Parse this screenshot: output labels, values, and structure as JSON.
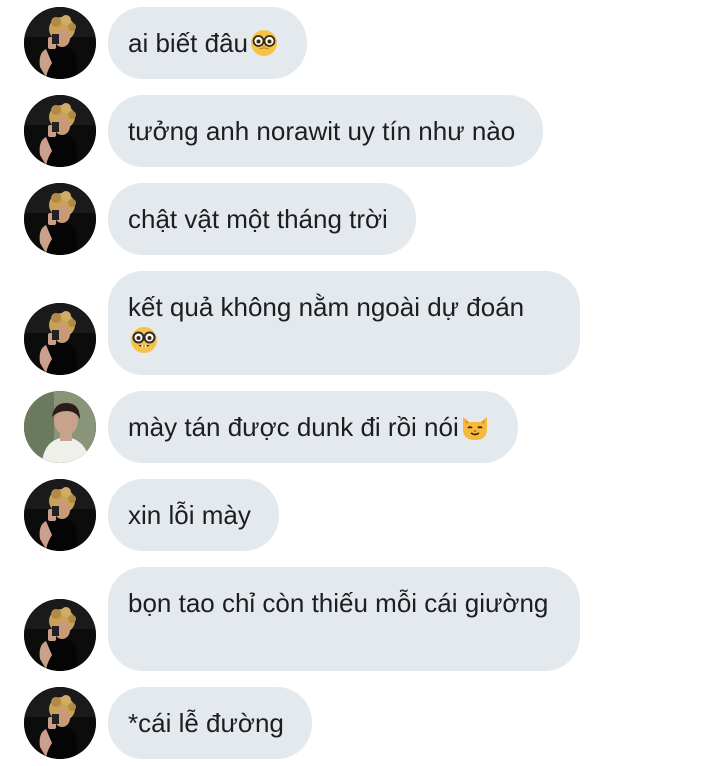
{
  "messages": [
    {
      "text": "ai biết đâu",
      "emoji": "disguised-face-emoji",
      "sender": "user-a"
    },
    {
      "text": "tưởng anh norawit uy tín như nào",
      "emoji": "",
      "sender": "user-a"
    },
    {
      "text": "chật vật một tháng trời",
      "emoji": "",
      "sender": "user-a"
    },
    {
      "text": "kết quả không nằm ngoài dự đoán",
      "emoji": "nerd-face-emoji",
      "sender": "user-a"
    },
    {
      "text": "mày tán được dunk đi rồi nói",
      "emoji": "cat-face-emoji",
      "sender": "user-b"
    },
    {
      "text": "xin lỗi mày",
      "emoji": "",
      "sender": "user-a"
    },
    {
      "text": "bọn tao chỉ còn thiếu mỗi cái giường",
      "emoji": "",
      "sender": "user-a"
    },
    {
      "text": "*cái lễ đường",
      "emoji": "",
      "sender": "user-a"
    }
  ],
  "colors": {
    "bubble": "#e4e9ee",
    "text": "#1c1e21",
    "background": "#ffffff"
  }
}
